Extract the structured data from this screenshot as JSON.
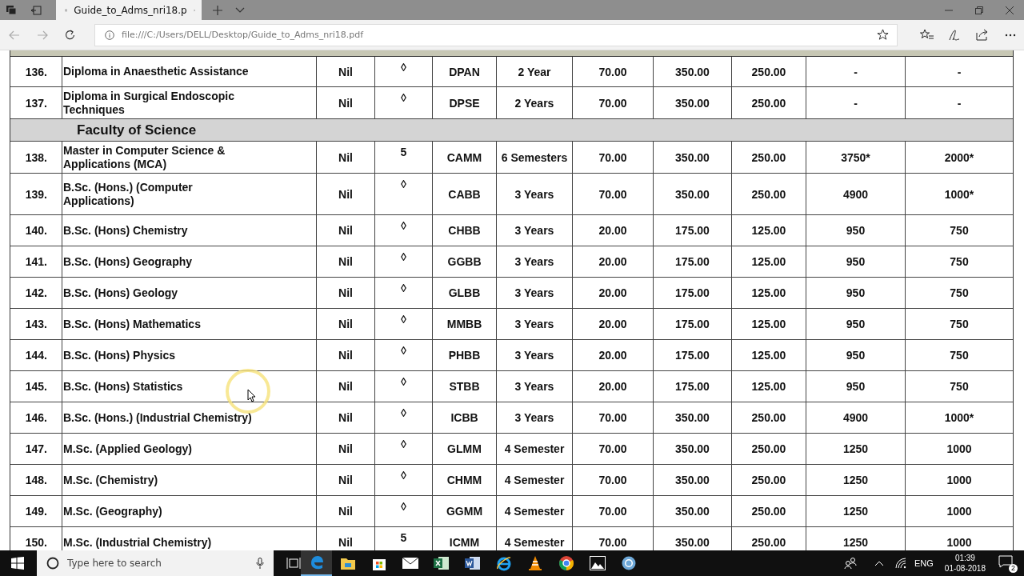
{
  "browser": {
    "tab_title": "Guide_to_Adms_nri18.p",
    "url": "file:///C:/Users/DELL/Desktop/Guide_to_Adms_nri18.pdf"
  },
  "table": {
    "rows": [
      {
        "kind": "course",
        "cells": [
          "136.",
          "Diploma in Anaesthetic Assistance",
          "Nil",
          "◊",
          "DPAN",
          "2 Year",
          "70.00",
          "350.00",
          "250.00",
          "-",
          "-"
        ]
      },
      {
        "kind": "course",
        "cells": [
          "137.",
          "Diploma in Surgical Endoscopic Techniques",
          "Nil",
          "◊",
          "DPSE",
          "2 Years",
          "70.00",
          "350.00",
          "250.00",
          "-",
          "-"
        ]
      },
      {
        "kind": "section",
        "title": "Faculty of Science"
      },
      {
        "kind": "course",
        "cells": [
          "138.",
          "Master in Computer Science & Applications (MCA)",
          "Nil",
          "5",
          "CAMM",
          "6 Semesters",
          "70.00",
          "350.00",
          "250.00",
          "3750*",
          "2000*"
        ]
      },
      {
        "kind": "course",
        "cells": [
          "139.",
          "B.Sc. (Hons.) (Computer Applications)",
          "Nil",
          "◊",
          "CABB",
          "3 Years",
          "70.00",
          "350.00",
          "250.00",
          "4900",
          "1000*"
        ]
      },
      {
        "kind": "course",
        "cells": [
          "140.",
          "B.Sc. (Hons) Chemistry",
          "Nil",
          "◊",
          "CHBB",
          "3 Years",
          "20.00",
          "175.00",
          "125.00",
          "950",
          "750"
        ]
      },
      {
        "kind": "course",
        "cells": [
          "141.",
          "B.Sc. (Hons) Geography",
          "Nil",
          "◊",
          "GGBB",
          "3 Years",
          "20.00",
          "175.00",
          "125.00",
          "950",
          "750"
        ]
      },
      {
        "kind": "course",
        "cells": [
          "142.",
          "B.Sc. (Hons) Geology",
          "Nil",
          "◊",
          "GLBB",
          "3 Years",
          "20.00",
          "175.00",
          "125.00",
          "950",
          "750"
        ]
      },
      {
        "kind": "course",
        "cells": [
          "143.",
          "B.Sc. (Hons) Mathematics",
          "Nil",
          "◊",
          "MMBB",
          "3 Years",
          "20.00",
          "175.00",
          "125.00",
          "950",
          "750"
        ]
      },
      {
        "kind": "course",
        "cells": [
          "144.",
          "B.Sc. (Hons) Physics",
          "Nil",
          "◊",
          "PHBB",
          "3 Years",
          "20.00",
          "175.00",
          "125.00",
          "950",
          "750"
        ]
      },
      {
        "kind": "course",
        "cells": [
          "145.",
          "B.Sc. (Hons) Statistics",
          "Nil",
          "◊",
          "STBB",
          "3 Years",
          "20.00",
          "175.00",
          "125.00",
          "950",
          "750"
        ]
      },
      {
        "kind": "course",
        "cells": [
          "146.",
          "B.Sc. (Hons.)  (Industrial Chemistry)",
          "Nil",
          "◊",
          "ICBB",
          "3 Years",
          "70.00",
          "350.00",
          "250.00",
          "4900",
          "1000*"
        ]
      },
      {
        "kind": "course",
        "cells": [
          "147.",
          "M.Sc. (Applied Geology)",
          "Nil",
          "◊",
          "GLMM",
          "4 Semester",
          "70.00",
          "350.00",
          "250.00",
          "1250",
          "1000"
        ]
      },
      {
        "kind": "course",
        "cells": [
          "148.",
          "M.Sc. (Chemistry)",
          "Nil",
          "◊",
          "CHMM",
          "4 Semester",
          "70.00",
          "350.00",
          "250.00",
          "1250",
          "1000"
        ]
      },
      {
        "kind": "course",
        "cells": [
          "149.",
          "M.Sc. (Geography)",
          "Nil",
          "◊",
          "GGMM",
          "4 Semester",
          "70.00",
          "350.00",
          "250.00",
          "1250",
          "1000"
        ]
      },
      {
        "kind": "course",
        "cells": [
          "150.",
          "M.Sc. (Industrial Chemistry)",
          "Nil",
          "5",
          "ICMM",
          "4 Semester",
          "70.00",
          "350.00",
          "250.00",
          "1250",
          "1000"
        ]
      }
    ]
  },
  "taskbar": {
    "search_placeholder": "Type here to search",
    "language": "ENG",
    "time": "01:39",
    "date": "01-08-2018",
    "notification_count": "2"
  }
}
